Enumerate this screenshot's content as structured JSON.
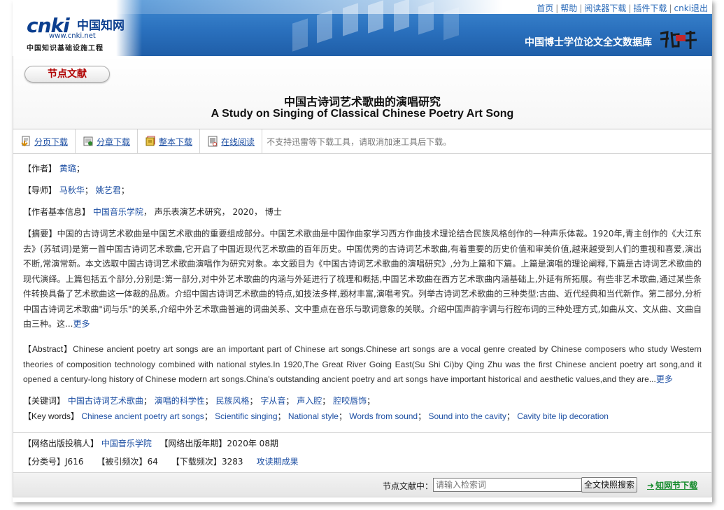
{
  "header": {
    "logo_text": "cnki",
    "logo_cn": "中国知网",
    "logo_url": "www.cnki.net",
    "logo_sub": "中国知识基础设施工程",
    "db_name": "中国博士学位论文全文数据库",
    "nav": [
      "首页",
      "帮助",
      "阅读器下载",
      "插件下载"
    ],
    "user": "cnki",
    "logout": "退出"
  },
  "node_pill": "节点文献",
  "title": {
    "cn": "中国古诗词艺术歌曲的演唱研究",
    "en": "A Study on Singing of Classical Chinese Poetry Art Song"
  },
  "download_bar": {
    "items": [
      {
        "label": "分页下载",
        "icon": "page-download-icon"
      },
      {
        "label": "分章下载",
        "icon": "chapter-download-icon"
      },
      {
        "label": "整本下载",
        "icon": "full-download-icon"
      },
      {
        "label": "在线阅读",
        "icon": "online-read-icon"
      }
    ],
    "note": "不支持迅雷等下载工具，请取消加速工具后下载。"
  },
  "info": {
    "author_label": "【作者】",
    "author": "黄璐",
    "advisor_label": "【导师】",
    "advisors": [
      "马秋华",
      "姚艺君"
    ],
    "author_info_label": "【作者基本信息】",
    "institution": "中国音乐学院",
    "author_info_rest": "， 声乐表演艺术研究， 2020， 博士",
    "abstract_label": "【摘要】",
    "abstract": "中国的古诗词艺术歌曲是中国艺术歌曲的重要组成部分。中国艺术歌曲是中国作曲家学习西方作曲技术理论结合民族风格创作的一种声乐体裁。1920年,青主创作的《大江东去》(苏轼词)是第一首中国古诗词艺术歌曲,它开启了中国近现代艺术歌曲的百年历史。中国优秀的古诗词艺术歌曲,有着重要的历史价值和审美价值,越来越受到人们的重视和喜爱,演出不断,常演常新。本文选取中国古诗词艺术歌曲演唱作为研究对象。本文题目为《中国古诗词艺术歌曲的演唱研究》,分为上篇和下篇。上篇是演唱的理论阐释,下篇是古诗词艺术歌曲的现代演绎。上篇包括五个部分,分别是:第一部分,对中外艺术歌曲的内涵与外延进行了梳理和概括,中国艺术歌曲在西方艺术歌曲内涵基础上,外延有所拓展。有些非艺术歌曲,通过某些条件转换具备了艺术歌曲这一体裁的品质。介绍中国古诗词艺术歌曲的特点,如技法多样,题材丰富,演唱考究。列举古诗词艺术歌曲的三种类型:古曲、近代经典和当代新作。第二部分,分析中国古诗词艺术歌曲\"词与乐\"的关系,介绍中外艺术歌曲普遍的词曲关系、文中重点在音乐与歌词意象的关联。介绍中国声韵字调与行腔布词的三种处理方式,如曲从文、文从曲、文曲自由三种。这...",
    "abstract_more": "更多",
    "abstract_en_label": "【Abstract】",
    "abstract_en": "Chinese ancient poetry art songs are an important part of Chinese art songs.Chinese art songs are a vocal genre created by Chinese composers who study Western theories of composition technology combined with national styles.In 1920,The Great River Going East(Su Shi Ci)by Qing Zhu was the first Chinese ancient poetry art song,and it opened a century-long history of Chinese modern art songs.China's outstanding ancient poetry and art songs have important historical and aesthetic values,and they are...",
    "abstract_en_more": "更多",
    "keywords_label": "【关键词】",
    "keywords": [
      "中国古诗词艺术歌曲",
      "演唱的科学性",
      "民族风格",
      "字从音",
      "声入腔",
      "腔咬唇饰"
    ],
    "keywords_en_label": "【Key words】",
    "keywords_en": [
      "Chinese ancient poetry art songs",
      "Scientific singing",
      "National style",
      "Words from sound",
      "Sound into the cavity",
      "Cavity bite lip decoration"
    ]
  },
  "pub": {
    "publisher_label": "【网络出版投稿人】",
    "publisher": "中国音乐学院",
    "date_label": "【网络出版年期】",
    "date": "2020年 08期",
    "class_label": "【分类号】",
    "class_no": "J616",
    "cited_label": "【被引频次】",
    "cited": "64",
    "downloads_label": "【下载频次】",
    "downloads": "3283",
    "attack_link": "攻读期成果"
  },
  "footer": {
    "label": "节点文献中：",
    "search_placeholder": "请输入检索词",
    "search_button": "全文快照搜索",
    "download_link": "知网节下载"
  }
}
